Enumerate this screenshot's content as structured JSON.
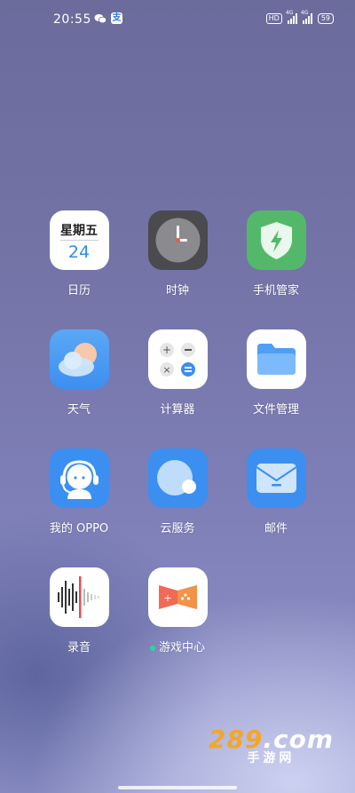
{
  "status_bar": {
    "time": "20:55",
    "hd_badge": "HD",
    "sig1_label": "4G",
    "sig2_label": "4G",
    "battery": "59",
    "alipay_glyph": "支"
  },
  "apps": [
    {
      "label": "日历",
      "weekday": "星期五",
      "day": "24",
      "icon": "calendar-icon"
    },
    {
      "label": "时钟",
      "icon": "clock-icon"
    },
    {
      "label": "手机管家",
      "icon": "phone-manager-icon"
    },
    {
      "label": "天气",
      "icon": "weather-icon"
    },
    {
      "label": "计算器",
      "icon": "calculator-icon"
    },
    {
      "label": "文件管理",
      "icon": "file-manager-icon"
    },
    {
      "label": "我的 OPPO",
      "icon": "my-oppo-icon"
    },
    {
      "label": "云服务",
      "icon": "cloud-service-icon"
    },
    {
      "label": "邮件",
      "icon": "mail-icon"
    },
    {
      "label": "录音",
      "icon": "recorder-icon"
    },
    {
      "label": "游戏中心",
      "icon": "game-center-icon",
      "new_dot": true
    }
  ],
  "watermark": {
    "brand_main": "289",
    "brand_suffix": ".com",
    "brand_sub": "手游网"
  },
  "colors": {
    "accent": "#2e8fe0",
    "dot_green": "#35d39c"
  }
}
